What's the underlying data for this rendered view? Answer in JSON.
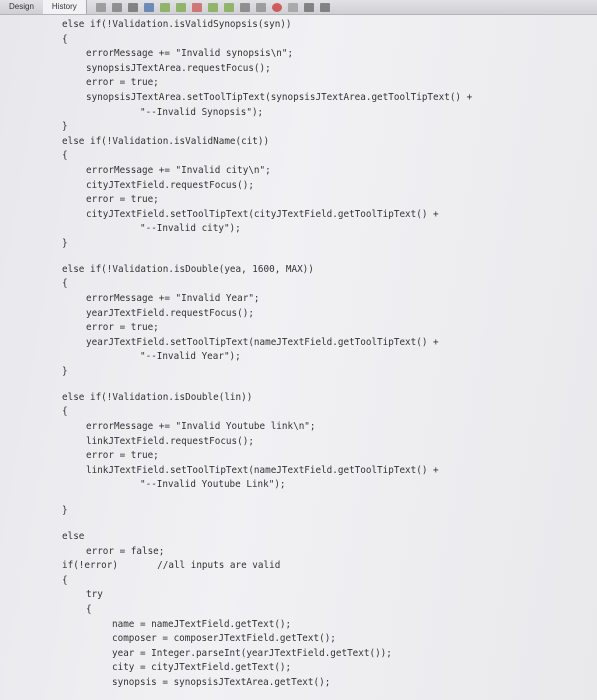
{
  "toolbar": {
    "tabs": [
      "Design",
      "History"
    ],
    "icons": [
      "source-icon",
      "history-icon",
      "back-icon",
      "search-icon",
      "prev-icon",
      "next-icon",
      "toggle-icon",
      "up-icon",
      "down-icon",
      "sort-icon",
      "diff-icon",
      "circle-icon",
      "square-icon",
      "menu-icon",
      "chart-icon"
    ]
  },
  "code": [
    {
      "i": 1,
      "t": "else if(!Validation.isValidSynopsis(syn))"
    },
    {
      "i": 1,
      "t": "{"
    },
    {
      "i": 2,
      "t": "errorMessage += \"Invalid synopsis\\n\";"
    },
    {
      "i": 2,
      "t": "synopsisJTextArea.requestFocus();"
    },
    {
      "i": 2,
      "t": "error = true;"
    },
    {
      "i": 2,
      "t": "synopsisJTextArea.setToolTipText(synopsisJTextArea.getToolTipText() +"
    },
    {
      "i": 3,
      "t": "\"--Invalid Synopsis\");"
    },
    {
      "i": 1,
      "t": "}"
    },
    {
      "i": 1,
      "t": "else if(!Validation.isValidName(cit))"
    },
    {
      "i": 1,
      "t": "{"
    },
    {
      "i": 2,
      "t": "errorMessage += \"Invalid city\\n\";"
    },
    {
      "i": 2,
      "t": "cityJTextField.requestFocus();"
    },
    {
      "i": 2,
      "t": "error = true;"
    },
    {
      "i": 2,
      "t": "cityJTextField.setToolTipText(cityJTextField.getToolTipText() +"
    },
    {
      "i": 3,
      "t": "\"--Invalid city\");"
    },
    {
      "i": 1,
      "t": "}"
    },
    {
      "i": 1,
      "t": ""
    },
    {
      "i": 1,
      "t": "else if(!Validation.isDouble(yea, 1600, MAX))"
    },
    {
      "i": 1,
      "t": "{"
    },
    {
      "i": 2,
      "t": "errorMessage += \"Invalid Year\";"
    },
    {
      "i": 2,
      "t": "yearJTextField.requestFocus();"
    },
    {
      "i": 2,
      "t": "error = true;"
    },
    {
      "i": 2,
      "t": "yearJTextField.setToolTipText(nameJTextField.getToolTipText() +"
    },
    {
      "i": 3,
      "t": "\"--Invalid Year\");"
    },
    {
      "i": 1,
      "t": "}"
    },
    {
      "i": 1,
      "t": ""
    },
    {
      "i": 1,
      "t": "else if(!Validation.isDouble(lin))"
    },
    {
      "i": 1,
      "t": "{"
    },
    {
      "i": 2,
      "t": "errorMessage += \"Invalid Youtube link\\n\";"
    },
    {
      "i": 2,
      "t": "linkJTextField.requestFocus();"
    },
    {
      "i": 2,
      "t": "error = true;"
    },
    {
      "i": 2,
      "t": "linkJTextField.setToolTipText(nameJTextField.getToolTipText() +"
    },
    {
      "i": 3,
      "t": "\"--Invalid Youtube Link\");"
    },
    {
      "i": 1,
      "t": ""
    },
    {
      "i": 1,
      "t": "}"
    },
    {
      "i": 1,
      "t": ""
    },
    {
      "i": 1,
      "t": "else"
    },
    {
      "i": 2,
      "t": "error = false;"
    },
    {
      "i": 1,
      "t": "if(!error)       //all inputs are valid"
    },
    {
      "i": 1,
      "t": "{"
    },
    {
      "i": 2,
      "t": "try"
    },
    {
      "i": 2,
      "t": "{"
    },
    {
      "i": 4,
      "t": "name = nameJTextField.getText();"
    },
    {
      "i": 4,
      "t": "composer = composerJTextField.getText();"
    },
    {
      "i": 4,
      "t": "year = Integer.parseInt(yearJTextField.getText());"
    },
    {
      "i": 4,
      "t": "city = cityJTextField.getText();"
    },
    {
      "i": 4,
      "t": "synopsis = synopsisJTextArea.getText();"
    }
  ]
}
